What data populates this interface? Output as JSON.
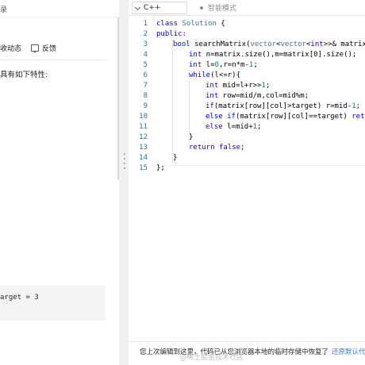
{
  "left_panel": {
    "top_partial_text": "录",
    "collect_label": "收动态",
    "feedback_label": "反馈",
    "problem_partial_text": "具有如下特性:",
    "example_partial_text": "arget = 3"
  },
  "toolbar": {
    "language": "C++",
    "mode_label": "智能模式"
  },
  "editor": {
    "line_numbers": [
      "1",
      "2",
      "3",
      "4",
      "5",
      "6",
      "7",
      "8",
      "9",
      "10",
      "11",
      "12",
      "13",
      "14",
      "15"
    ],
    "code": {
      "l1_kw": "class",
      "l1_ty": " Solution",
      "l1_rest": " {",
      "l2": "public:",
      "l3_kw": "bool",
      "l3_a": " searchMatrix(",
      "l3_ty1": "vector",
      "l3_b": "<",
      "l3_ty2": "vector",
      "l3_c": "<",
      "l3_kw2": "int",
      "l3_d": ">>& matrix, i",
      "l4_kw": "int",
      "l4_rest": " n=matrix.size(),m=matrix[0].size();",
      "l5_kw": "int",
      "l5_a": " l=",
      "l5_n1": "0",
      "l5_b": ",r=n*m-",
      "l5_n2": "1",
      "l5_c": ";",
      "l6_kw": "while",
      "l6_rest": "(l<=r){",
      "l7_kw": "int",
      "l7_a": " mid=l+r>>",
      "l7_n": "1",
      "l7_b": ";",
      "l8_kw": "int",
      "l8_rest": " row=mid/m,col=mid%m;",
      "l9_kw": "if",
      "l9_a": "(matrix[row][col]>target) r=mid-",
      "l9_n": "1",
      "l9_b": ";",
      "l10_kw1": "else",
      "l10_sp": " ",
      "l10_kw2": "if",
      "l10_a": "(matrix[row][col]==target) ",
      "l10_kw3": "return",
      "l11_kw": "else",
      "l11_a": " l=mid+",
      "l11_n": "1",
      "l11_b": ";",
      "l12": "}",
      "l13_kw1": "return",
      "l13_sp": " ",
      "l13_kw2": "false",
      "l13_b": ";",
      "l14": "}",
      "l15": "};"
    }
  },
  "footer": {
    "restore_message": "您上次编辑到这里，代码已从您浏览器本地的临时存储中恢复了",
    "restore_link": "还原默认代",
    "watermark": "@稀土掘金技术社区"
  }
}
